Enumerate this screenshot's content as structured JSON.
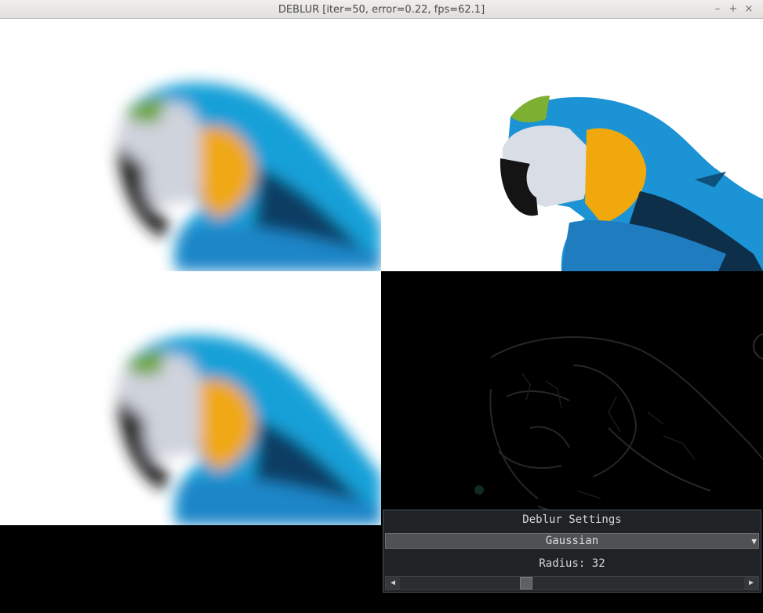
{
  "window": {
    "title": "DEBLUR [iter=50, error=0.22, fps=62.1]",
    "minimize_glyph": "–",
    "maximize_glyph": "+",
    "close_glyph": "×"
  },
  "settings": {
    "title": "Deblur Settings",
    "kernel_selected": "Gaussian",
    "dropdown_arrow_icon": "triangle-down-icon",
    "radius_label": "Radius:",
    "radius_value": "32",
    "slider_fraction": 0.36,
    "slider_left_icon": "arrow-left-icon",
    "slider_right_icon": "arrow-right-icon"
  },
  "colors": {
    "blue": "#1a8fd6",
    "yellow": "#f2ac10",
    "panel_bg": "#1f2326"
  }
}
